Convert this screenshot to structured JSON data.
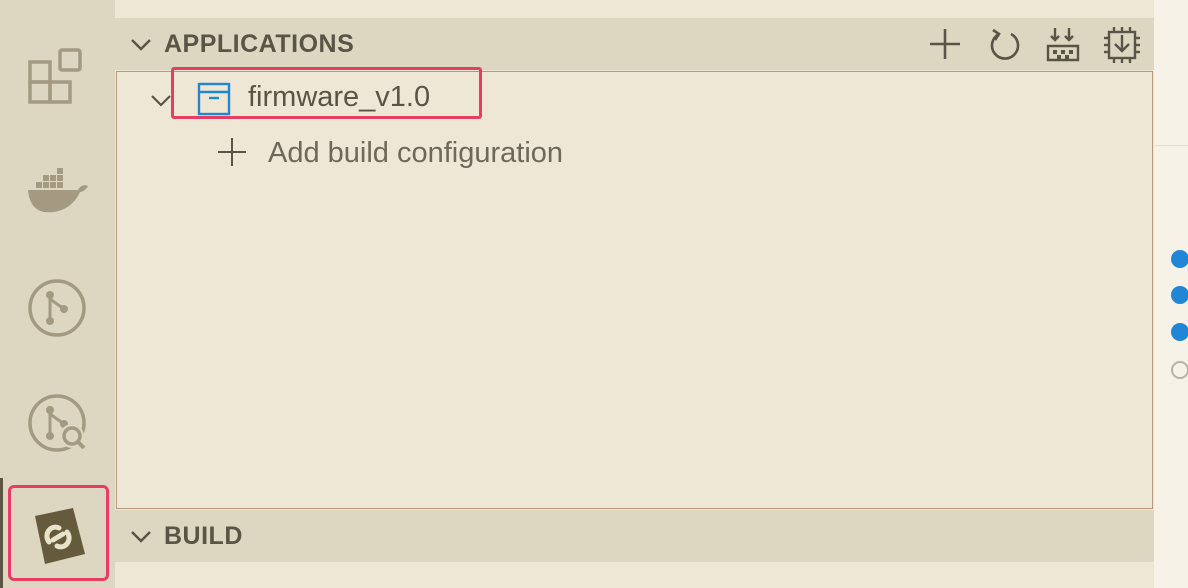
{
  "activity_bar": {
    "items": [
      {
        "name": "extensions-icon"
      },
      {
        "name": "docker-icon"
      },
      {
        "name": "source-control-icon"
      },
      {
        "name": "git-graph-icon"
      },
      {
        "name": "nrf-connect-icon",
        "active": true
      }
    ]
  },
  "sections": {
    "applications": {
      "title": "APPLICATIONS",
      "actions": [
        "add-icon",
        "refresh-icon",
        "open-sample-icon",
        "build-all-icon"
      ],
      "items": [
        {
          "label": "firmware_v1.0",
          "icon": "application-box-icon",
          "expanded": true
        }
      ],
      "add_build_label": "Add build configuration"
    },
    "build": {
      "title": "BUILD"
    }
  },
  "colors": {
    "highlight": "#e53e64",
    "accent_blue": "#1f87d6",
    "text": "#5a5447"
  }
}
